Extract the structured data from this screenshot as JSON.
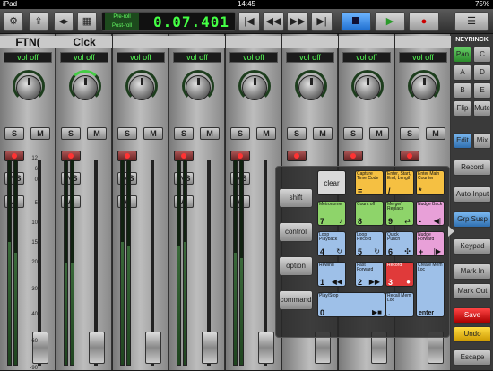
{
  "statusbar": {
    "device": "iPad",
    "time": "14:45",
    "battery": "75%"
  },
  "toolbar": {
    "counter": {
      "preroll": "Pre-roll",
      "postroll": "Post-roll",
      "time": "0.07.401"
    },
    "menu_icon": "hamburger-icon"
  },
  "tracks": [
    {
      "name": "FTN(",
      "vol": "vol off"
    },
    {
      "name": "Clck",
      "vol": "vol off"
    },
    {
      "name": "",
      "vol": "vol off"
    },
    {
      "name": "",
      "vol": "vol off"
    },
    {
      "name": "",
      "vol": "vol off"
    },
    {
      "name": "",
      "vol": "vol off"
    },
    {
      "name": "",
      "vol": "vol off"
    },
    {
      "name": "",
      "vol": "vol off"
    }
  ],
  "strip_labels": {
    "solo": "S",
    "mute": "M",
    "ins": "INS",
    "auto": "A"
  },
  "meter_scale": [
    "12",
    "6",
    "0",
    "5",
    "10",
    "15",
    "20",
    "30",
    "40",
    "60",
    "-90"
  ],
  "right_panel": {
    "brand": "NEYRINCK",
    "pan": "Pan",
    "c": "C",
    "a": "A",
    "b": "B",
    "d": "D",
    "e": "E",
    "flip": "Flip",
    "mute": "Mute",
    "edit": "Edit",
    "mix": "Mix",
    "buttons": [
      "Record",
      "Auto Input",
      "Grp Susp",
      "Keypad",
      "Mark In",
      "Mark Out",
      "Save",
      "Undo",
      "Escape"
    ]
  },
  "keypad": {
    "modifiers": [
      "shift",
      "control",
      "option",
      "command"
    ],
    "keys": [
      {
        "label": "clear",
        "num": "",
        "color": "#d9d9d9"
      },
      {
        "label": "Capture Time Code",
        "num": "=",
        "color": "#f5c042"
      },
      {
        "label": "Enter, Start, End, Length",
        "num": "/",
        "color": "#f5c042"
      },
      {
        "label": "Enter Main Counter",
        "num": "*",
        "color": "#f5c042"
      },
      {
        "label": "Metronome",
        "num": "7",
        "color": "#8ed46a"
      },
      {
        "label": "Count off",
        "num": "8",
        "color": "#8ed46a"
      },
      {
        "label": "Merge/ Replace",
        "num": "9",
        "color": "#8ed46a"
      },
      {
        "label": "Nudge Back",
        "num": "-",
        "color": "#e8a0d8"
      },
      {
        "label": "Loop Playback",
        "num": "4",
        "color": "#9ec0e8"
      },
      {
        "label": "Loop Record",
        "num": "5",
        "color": "#9ec0e8"
      },
      {
        "label": "Quick Punch",
        "num": "6",
        "color": "#9ec0e8"
      },
      {
        "label": "Nudge Forward",
        "num": "+",
        "color": "#e8a0d8"
      },
      {
        "label": "Rewind",
        "num": "1",
        "color": "#9ec0e8"
      },
      {
        "label": "Fast Forward",
        "num": "2",
        "color": "#9ec0e8"
      },
      {
        "label": "Record",
        "num": "3",
        "color": "#e03a3a"
      },
      {
        "label": "Create Mem Loc",
        "num": "enter",
        "color": "#9ec0e8"
      },
      {
        "label": "Play/Stop",
        "num": "0",
        "color": "#9ec0e8"
      },
      {
        "label": "Recall Mem Loc",
        "num": ".",
        "color": "#9ec0e8"
      }
    ]
  }
}
